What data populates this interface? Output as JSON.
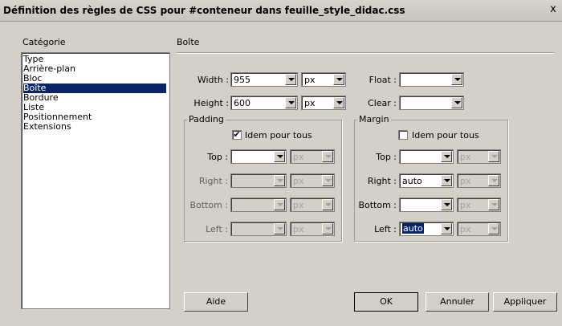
{
  "window": {
    "title": "Définition des règles de CSS pour #conteneur dans feuille_style_didac.css",
    "close": "x"
  },
  "category": {
    "label": "Catégorie",
    "items": [
      "Type",
      "Arrière-plan",
      "Bloc",
      "Boîte",
      "Bordure",
      "Liste",
      "Positionnement",
      "Extensions"
    ],
    "selected": "Boîte"
  },
  "panel": {
    "title": "Boîte"
  },
  "box": {
    "width_label": "Width :",
    "width_value": "955",
    "width_unit": "px",
    "height_label": "Height :",
    "height_value": "600",
    "height_unit": "px",
    "float_label": "Float :",
    "float_value": "",
    "clear_label": "Clear :",
    "clear_value": ""
  },
  "padding": {
    "legend": "Padding",
    "same_label": "Idem pour tous",
    "same_checked": true,
    "check_mark": "✔",
    "top_label": "Top :",
    "right_label": "Right :",
    "bottom_label": "Bottom :",
    "left_label": "Left :",
    "top_value": "",
    "right_value": "",
    "bottom_value": "",
    "left_value": "",
    "unit": "px"
  },
  "margin": {
    "legend": "Margin",
    "same_label": "Idem pour tous",
    "same_checked": false,
    "top_label": "Top :",
    "right_label": "Right :",
    "bottom_label": "Bottom :",
    "left_label": "Left :",
    "top_value": "",
    "right_value": "auto",
    "bottom_value": "",
    "left_value": "auto",
    "unit": "px"
  },
  "buttons": {
    "help": "Aide",
    "ok": "OK",
    "cancel": "Annuler",
    "apply": "Appliquer"
  },
  "colors": {
    "face": "#d4d0c8",
    "selection": "#0a246a"
  }
}
